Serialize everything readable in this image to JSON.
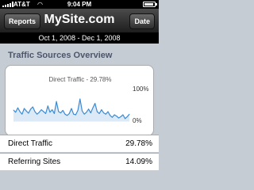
{
  "status_bar": {
    "carrier": "AT&T",
    "time": "9:04 PM",
    "battery_level": 0.9
  },
  "nav": {
    "left_button": "Reports",
    "title": "MySite.com",
    "right_button": "Date"
  },
  "date_range": "Oct 1, 2008 - Dec 1, 2008",
  "section_title": "Traffic Sources Overview",
  "chart_data": {
    "type": "line",
    "title": "Direct Traffic - 29.78%",
    "y_tick_labels": [
      "100%",
      "0%"
    ],
    "ylim": [
      0,
      100
    ],
    "line_color": "#3a8ad3",
    "fill_color": "#dceaf8",
    "values": [
      35,
      28,
      42,
      30,
      22,
      40,
      32,
      25,
      38,
      45,
      30,
      22,
      28,
      36,
      30,
      24,
      48,
      28,
      36,
      24,
      62,
      30,
      26,
      34,
      22,
      18,
      24,
      40,
      22,
      20,
      34,
      70,
      32,
      22,
      28,
      38,
      26,
      42,
      56,
      30,
      24,
      36,
      26,
      22,
      30,
      18,
      12,
      20,
      16,
      10,
      14,
      20,
      8,
      14,
      22
    ]
  },
  "table": {
    "rows": [
      {
        "label": "Direct Traffic",
        "value": "29.78%"
      },
      {
        "label": "Referring Sites",
        "value": "14.09%"
      }
    ]
  }
}
